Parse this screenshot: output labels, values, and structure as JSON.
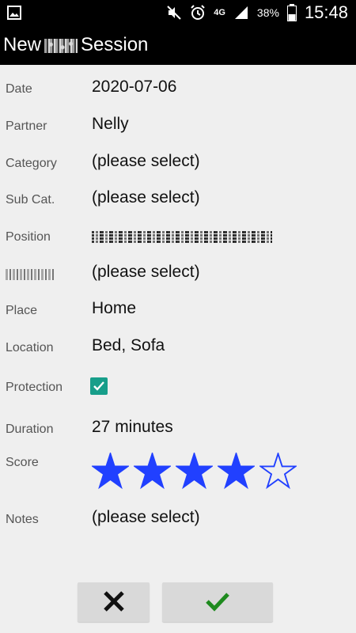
{
  "status_bar": {
    "network": "4G",
    "battery": "38%",
    "time": "15:48"
  },
  "app_bar": {
    "title_prefix": "New",
    "title_suffix": "Session"
  },
  "form": {
    "date": {
      "label": "Date",
      "value": "2020-07-06"
    },
    "partner": {
      "label": "Partner",
      "value": "Nelly"
    },
    "category": {
      "label": "Category",
      "value": "(please select)"
    },
    "subcat": {
      "label": "Sub Cat.",
      "value": "(please select)"
    },
    "position": {
      "label": "Position"
    },
    "hidden_field": {
      "value": "(please select)"
    },
    "place": {
      "label": "Place",
      "value": "Home"
    },
    "location": {
      "label": "Location",
      "value": "Bed, Sofa"
    },
    "protection": {
      "label": "Protection",
      "checked": true
    },
    "duration": {
      "label": "Duration",
      "value": "27 minutes"
    },
    "score": {
      "label": "Score",
      "rating": 4,
      "max": 5
    },
    "notes": {
      "label": "Notes",
      "value": "(please select)"
    }
  },
  "colors": {
    "star_blue": "#2140ff",
    "checkbox_teal": "#179e8a",
    "ok_green": "#1e8a1e"
  },
  "icons": {
    "cancel": "close-icon",
    "confirm": "check-icon"
  }
}
